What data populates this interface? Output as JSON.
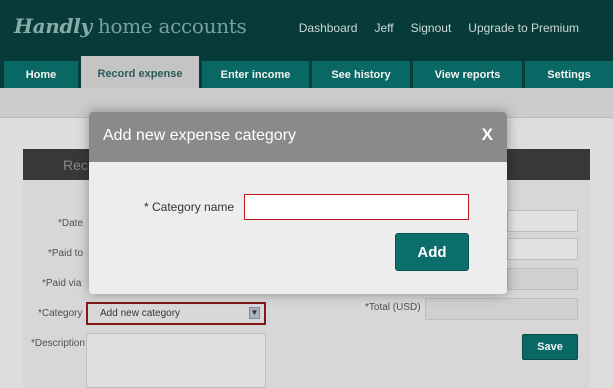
{
  "header": {
    "logo_script": "Handly",
    "logo_text": "home accounts",
    "nav": [
      "Dashboard",
      "Jeff",
      "Signout",
      "Upgrade to Premium"
    ]
  },
  "tabs": [
    {
      "label": "Home",
      "active": false
    },
    {
      "label": "Record expense",
      "active": true
    },
    {
      "label": "Enter income",
      "active": false
    },
    {
      "label": "See history",
      "active": false
    },
    {
      "label": "View reports",
      "active": false
    },
    {
      "label": "Settings",
      "active": false
    }
  ],
  "form": {
    "title_partial": "Rec",
    "labels": {
      "date": "*Date",
      "paid_to": "*Paid to",
      "paid_via": "*Paid via",
      "category": "*Category",
      "description": "*Description",
      "total": "*Total (USD)"
    },
    "category_value": "Add new category",
    "save_label": "Save"
  },
  "modal": {
    "title": "Add new expense category",
    "close_label": "X",
    "field_label": "* Category name",
    "field_value": "",
    "add_label": "Add"
  },
  "colors": {
    "brand": "#0b6e6a",
    "header_bg": "#073f3d",
    "error_border": "#c0171b"
  }
}
